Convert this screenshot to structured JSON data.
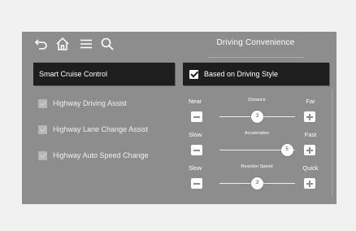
{
  "header": {
    "title": "Driving Convenience",
    "icons": [
      "back-icon",
      "home-icon",
      "menu-icon",
      "search-icon"
    ]
  },
  "left_menu": {
    "selected_label": "Smart Cruise Control",
    "options": [
      {
        "label": "Highway Driving Assist",
        "checked": true
      },
      {
        "label": "Highway Lane Change Assist",
        "checked": true
      },
      {
        "label": "Highway Auto Speed Change",
        "checked": true
      }
    ]
  },
  "right_panel": {
    "style_label": "Based on Driving Style",
    "style_checked": true,
    "settings": [
      {
        "name": "Distance",
        "low": "Near",
        "high": "Far",
        "value": "3",
        "min": 1,
        "max": 5
      },
      {
        "name": "Acceleration",
        "low": "Slow",
        "high": "Fast",
        "value": "5",
        "min": 1,
        "max": 5
      },
      {
        "name": "Reaction Speed",
        "low": "Slow",
        "high": "Quick",
        "value": "3",
        "min": 1,
        "max": 5
      }
    ]
  },
  "colors": {
    "screen_bg": "#8d8d8d",
    "selected_bg": "#1e1e1e",
    "text": "#ffffff"
  }
}
